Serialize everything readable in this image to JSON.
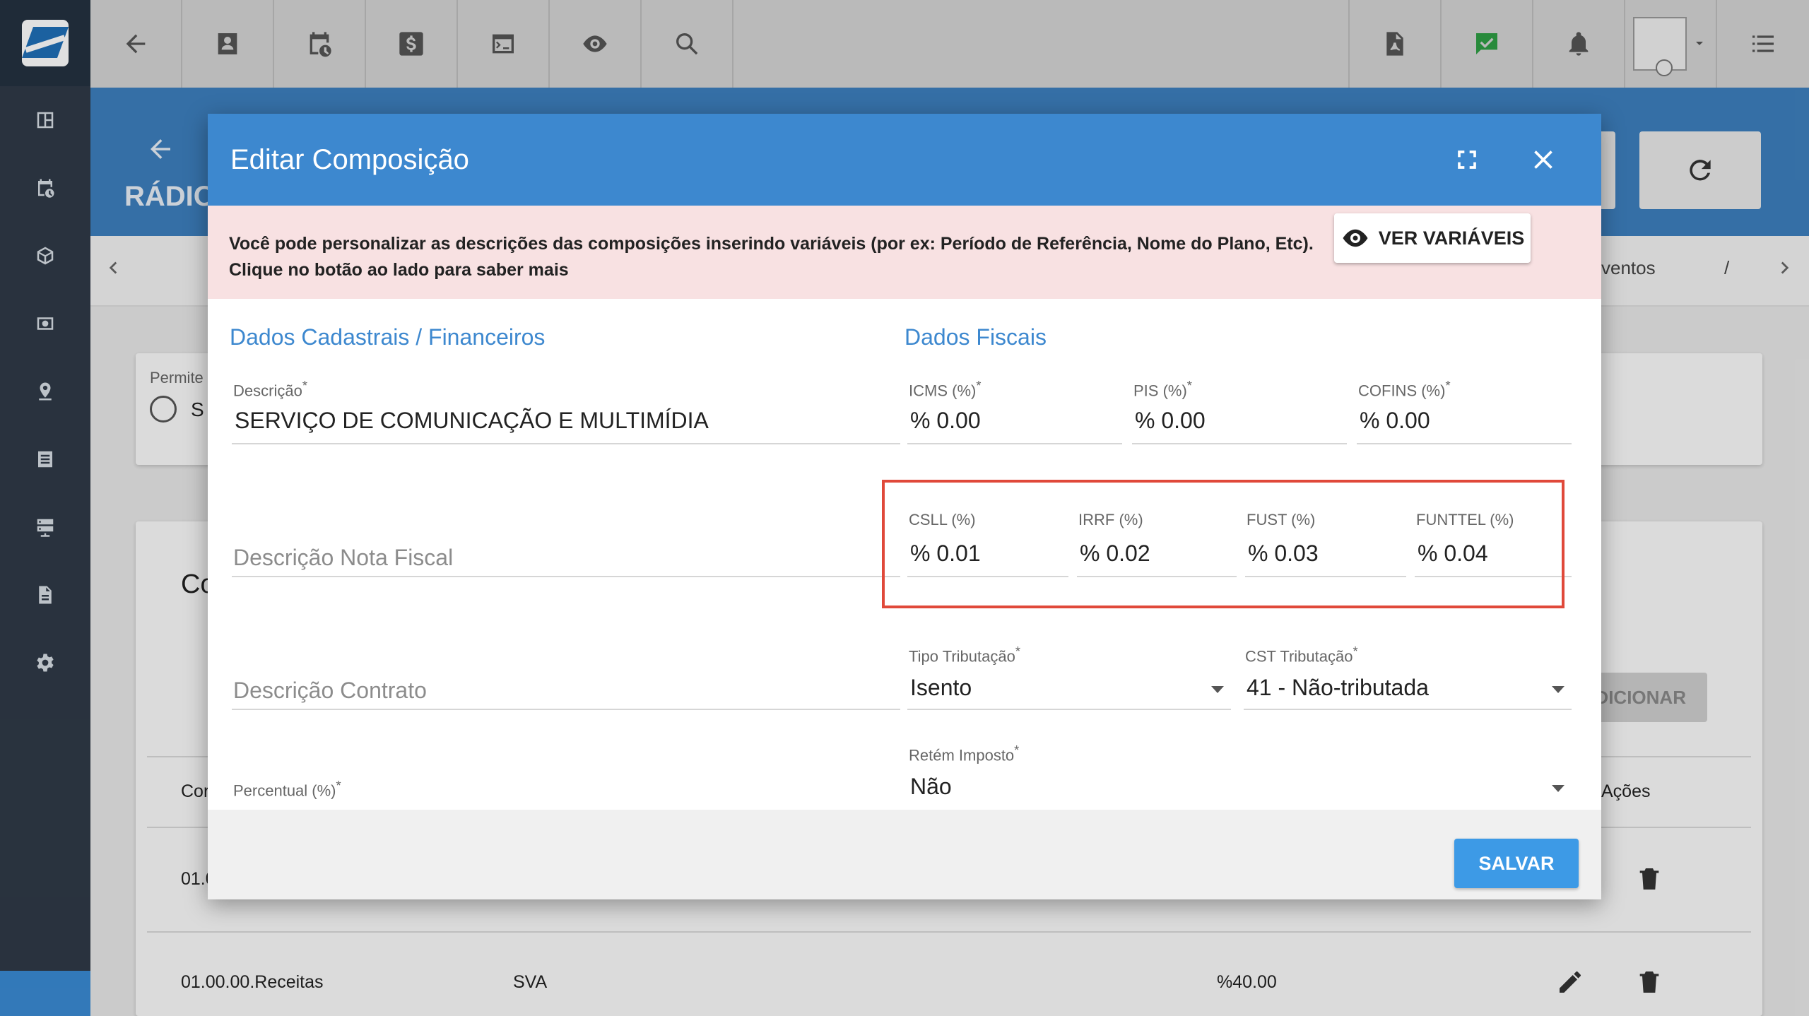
{
  "page": {
    "title_partial": "RÁDIO",
    "tab_partial_left": "(",
    "tab_partial_right": "ventos",
    "tab_partial_right2": "/"
  },
  "background": {
    "permite_label": "Permite",
    "radio_label_partial": "S",
    "card_title_partial": "Co",
    "add_button": "ADICIONAR",
    "col_first_partial": "Cor",
    "col_actions": "Ações",
    "row1_code_partial": "01.0",
    "row2": {
      "code": "01.00.00.Receitas",
      "type": "SVA",
      "percent": "%40.00"
    }
  },
  "modal": {
    "title": "Editar Composição",
    "info_line1": "Você pode personalizar as descrições das composições inserindo variáveis (por ex: Período de Referência, Nome do Plano, Etc).",
    "info_line2": "Clique no botão ao lado para saber mais",
    "vars_button": "VER VARIÁVEIS",
    "section_left": "Dados Cadastrais / Financeiros",
    "section_right": "Dados Fiscais",
    "descricao": {
      "label": "Descrição",
      "value": "SERVIÇO DE COMUNICAÇÃO E MULTIMÍDIA"
    },
    "descricao_nf": {
      "placeholder": "Descrição Nota Fiscal"
    },
    "descricao_contrato": {
      "placeholder": "Descrição Contrato"
    },
    "percentual": {
      "label": "Percentual (%)"
    },
    "icms": {
      "label": "ICMS (%)",
      "value": "% 0.00"
    },
    "pis": {
      "label": "PIS (%)",
      "value": "% 0.00"
    },
    "cofins": {
      "label": "COFINS (%)",
      "value": "% 0.00"
    },
    "csll": {
      "label": "CSLL (%)",
      "value": "% 0.01"
    },
    "irrf": {
      "label": "IRRF (%)",
      "value": "% 0.02"
    },
    "fust": {
      "label": "FUST (%)",
      "value": "% 0.03"
    },
    "funttel": {
      "label": "FUNTTEL (%)",
      "value": "% 0.04"
    },
    "tipo_tributacao": {
      "label": "Tipo Tributação",
      "value": "Isento"
    },
    "cst_tributacao": {
      "label": "CST Tributação",
      "value": "41 - Não-tributada"
    },
    "retem_imposto": {
      "label": "Retém Imposto",
      "value": "Não"
    },
    "required_mark": "*",
    "save_button": "SALVAR"
  },
  "colors": {
    "primary": "#3d88cf",
    "sidebar": "#2f3a47",
    "highlight": "#e0493a",
    "info_bg": "#f8e1e2"
  }
}
